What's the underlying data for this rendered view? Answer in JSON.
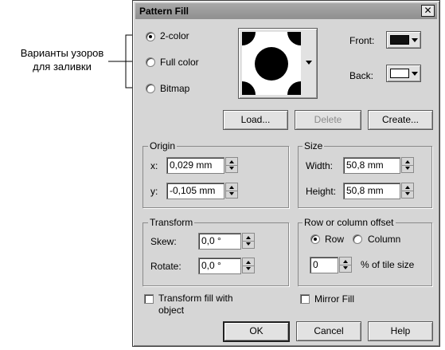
{
  "annotation": {
    "line1": "Варианты узоров",
    "line2": "для заливки"
  },
  "dialog": {
    "title": "Pattern Fill",
    "close_glyph": "✕"
  },
  "pattern_type": {
    "options": [
      "2-color",
      "Full color",
      "Bitmap"
    ],
    "selected": "2-color"
  },
  "colors": {
    "front_label": "Front:",
    "front_color": "#111111",
    "back_label": "Back:",
    "back_color": "#ffffff"
  },
  "buttons": {
    "load": "Load...",
    "delete": "Delete",
    "create": "Create...",
    "ok": "OK",
    "cancel": "Cancel",
    "help": "Help"
  },
  "origin": {
    "title": "Origin",
    "x_label": "x:",
    "x_value": "0,029 mm",
    "y_label": "y:",
    "y_value": "-0,105 mm"
  },
  "size": {
    "title": "Size",
    "width_label": "Width:",
    "width_value": "50,8 mm",
    "height_label": "Height:",
    "height_value": "50,8 mm"
  },
  "transform": {
    "title": "Transform",
    "skew_label": "Skew:",
    "skew_value": "0,0 °",
    "rotate_label": "Rotate:",
    "rotate_value": "0,0 °"
  },
  "offset": {
    "title": "Row or column offset",
    "row_label": "Row",
    "column_label": "Column",
    "selected": "Row",
    "percent_value": "0",
    "percent_label": "% of tile size"
  },
  "checkboxes": {
    "transform_fill_line1": "Transform fill with",
    "transform_fill_line2": "object",
    "mirror_fill": "Mirror Fill"
  }
}
